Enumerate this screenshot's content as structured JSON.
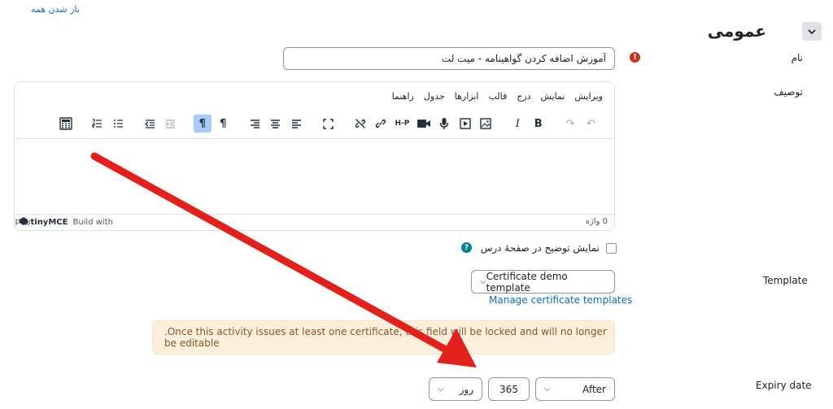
{
  "header": {
    "expand_all": "باز شدن همه",
    "section_title": "عمومی"
  },
  "form": {
    "name_label": "نام",
    "name_value": "آموزش اضافه کردن گواهینامه - میت لت",
    "description_label": "توصیف",
    "show_description_label": "نمایش توضیح در صفحهٔ درس",
    "template_label": "Template",
    "template_selected": "Certificate demo template",
    "manage_templates_link": "Manage certificate templates",
    "lock_notice": ".Once this activity issues at least one certificate, this field will be locked and will no longer be editable",
    "expiry_label": "Expiry date",
    "expiry_relation": "After",
    "expiry_amount": "365",
    "expiry_unit": "روز"
  },
  "editor": {
    "menu": [
      "ویرایش",
      "نمایش",
      "درج",
      "قالب",
      "ابزارها",
      "جدول",
      "راهنما"
    ],
    "word_count": "0 واژه",
    "built_with": "Build with",
    "brand": "tinyMCE",
    "path": "p",
    "toolbar": {
      "undo": "↶",
      "redo": "↷",
      "bold": "B",
      "italic": "I",
      "h5p": "H-P",
      "ltr": "¶",
      "rtl": "¶"
    }
  },
  "colors": {
    "link": "#0f6cbf",
    "required": "#ca3120",
    "help": "#008196",
    "alert_bg": "#fcefdc",
    "annotation_arrow": "#e3211c"
  }
}
